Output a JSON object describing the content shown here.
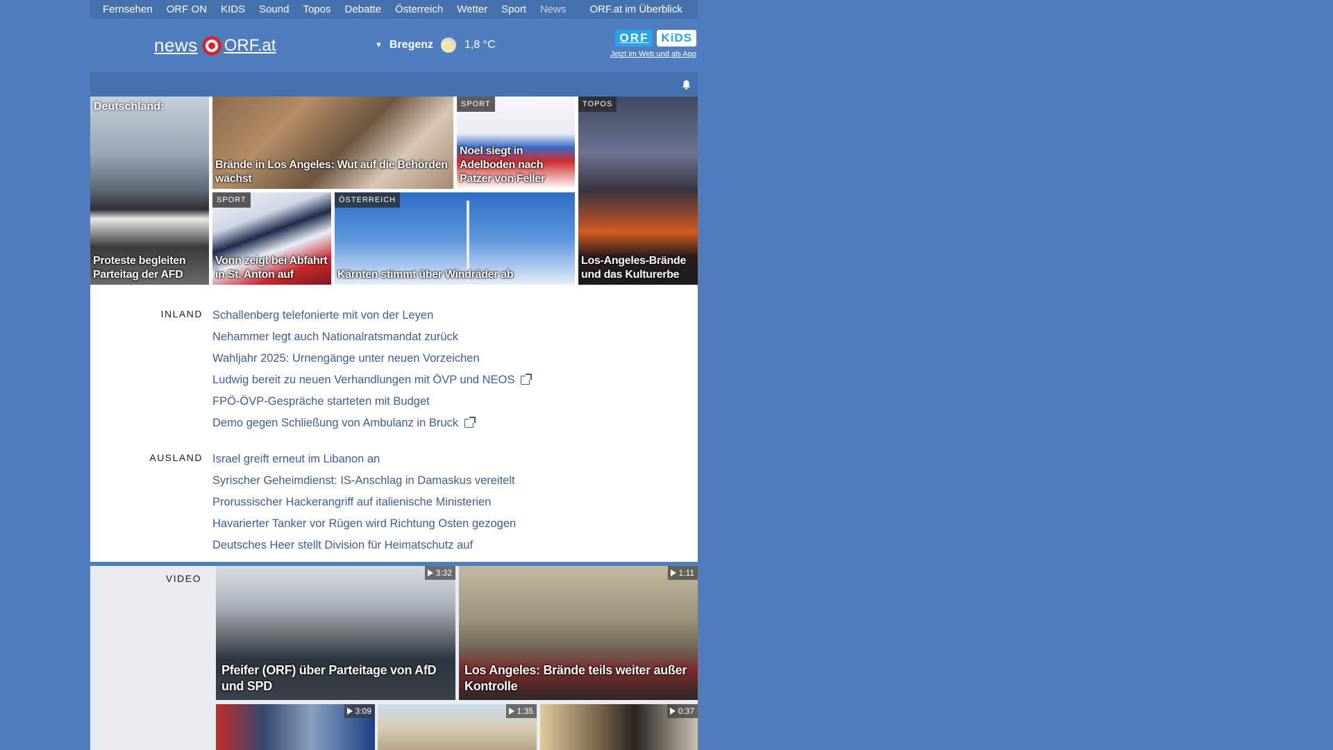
{
  "nav": {
    "items": [
      "Fernsehen",
      "ORF ON",
      "KIDS",
      "Sound",
      "Topos",
      "Debatte",
      "Österreich",
      "Wetter",
      "Sport"
    ],
    "current": "News",
    "overview": "ORF.at im Überblick"
  },
  "header": {
    "logo_news": "news",
    "logo_orf": "ORF.at",
    "weather_location": "Bregenz",
    "weather_temp": "1,8 °C",
    "weather_icon": "moon-cloud-icon",
    "kids_orf": "ORF",
    "kids_label": "KiDS",
    "kids_tagline": "Jetzt im Web und als App"
  },
  "teasers": [
    {
      "label": "",
      "title": "Proteste begleiten Parteitag der AFD",
      "top": "Deutschland:"
    },
    {
      "label": "",
      "title": "Brände in Los Angeles: Wut auf die Behörden wächst"
    },
    {
      "label": "SPORT",
      "title": "Noel siegt in Adelboden nach Patzer von Feller"
    },
    {
      "label": "TOPOS",
      "title": "Los-Angeles-Brände und das Kulturerbe"
    },
    {
      "label": "SPORT",
      "title": "Vonn zeigt bei Abfahrt in St. Anton auf"
    },
    {
      "label": "ÖSTERREICH",
      "title": "Kärnten stimmt über Windräder ab"
    }
  ],
  "inland": {
    "label": "INLAND",
    "items": [
      "Schallenberg telefonierte mit von der Leyen",
      "Nehammer legt auch Nationalratsmandat zurück",
      "Wahljahr 2025: Urnengänge unter neuen Vorzeichen",
      "Ludwig bereit zu neuen Verhandlungen mit ÖVP und NEOS",
      "FPÖ-ÖVP-Gespräche starteten mit Budget",
      "Demo gegen Schließung von Ambulanz in Bruck"
    ]
  },
  "ausland": {
    "label": "AUSLAND",
    "items": [
      "Israel greift erneut im Libanon an",
      "Syrischer Geheimdienst: IS-Anschlag in Damaskus vereitelt",
      "Prorussischer Hackerangriff auf italienische Ministerien",
      "Havarierter Tanker vor Rügen wird Richtung Osten gezogen",
      "Deutsches Heer stellt Division für Heimatschutz auf"
    ]
  },
  "video": {
    "label": "VIDEO",
    "items": [
      {
        "duration": "3:32",
        "title": "Pfeifer (ORF) über Parteitage von AfD und SPD"
      },
      {
        "duration": "1:11",
        "title": "Los Angeles: Brände teils weiter außer Kontrolle"
      },
      {
        "duration": "3:09",
        "title": ""
      },
      {
        "duration": "1:35",
        "title": ""
      },
      {
        "duration": "0:37",
        "title": ""
      }
    ]
  },
  "colors": {
    "background": "#4f7ebf",
    "nav": "#4571ad",
    "link": "#3a5f97"
  }
}
